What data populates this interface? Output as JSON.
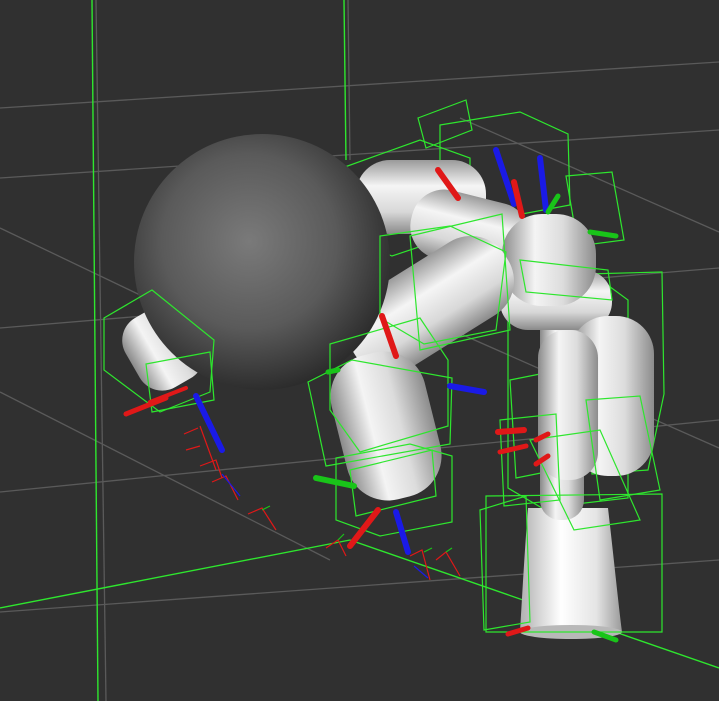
{
  "viewport": {
    "background": "#303030",
    "grid_color": "#5a5a5a",
    "bounding_box_color": "#2ee62e",
    "axis_colors": {
      "x": "#e01818",
      "y": "#19c419",
      "z": "#1a1ae6"
    },
    "show_grid": true,
    "show_bounding_boxes": true,
    "show_link_frames": true
  },
  "scene": {
    "objects": [
      {
        "name": "sphere-obstacle",
        "shape": "sphere",
        "shading": "grey"
      },
      {
        "name": "robot-arm-left",
        "shape": "capsule-links",
        "shading": "white"
      },
      {
        "name": "robot-arm-right",
        "shape": "capsule-links",
        "shading": "white"
      },
      {
        "name": "robot-torso",
        "shape": "capsule-links",
        "shading": "white"
      },
      {
        "name": "robot-base",
        "shape": "cylinder",
        "shading": "white"
      }
    ]
  }
}
